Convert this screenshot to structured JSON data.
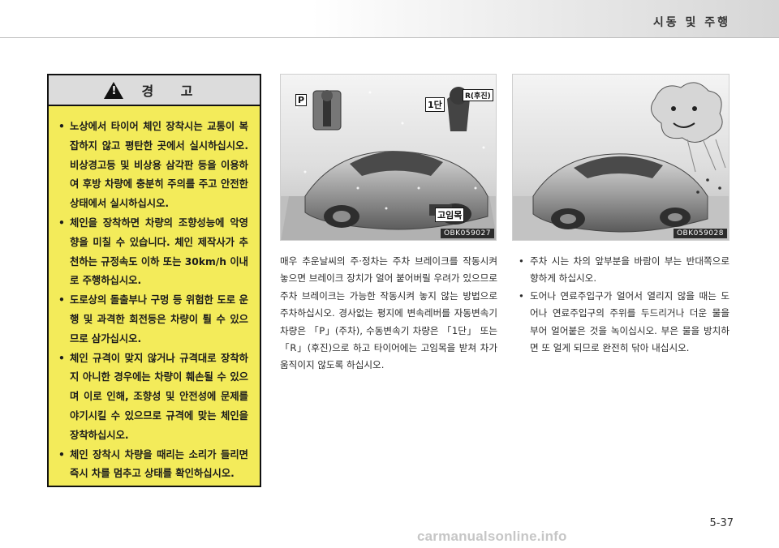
{
  "header": {
    "section_title": "시동 및 주행"
  },
  "warning": {
    "heading": "경 고",
    "items": [
      "노상에서 타이어 체인 장착시는 교통이 복잡하지 않고 평탄한 곳에서 실시하십시오. 비상경고등 및 비상용 삼각판 등을 이용하여 후방 차량에 충분히 주의를 주고 안전한 상태에서 실시하십시오.",
      "체인을 장착하면 차량의 조향성능에 악영향을 미칠 수 있습니다. 체인 제작사가 추천하는 규정속도 이하 또는 30km/h 이내로 주행하십시오.",
      "도로상의 돌출부나 구멍 등 위험한 도로 운행 및 과격한 회전등은 차량이 튈 수 있으므로 삼가십시오.",
      "체인 규격이 맞지 않거나 규격대로 장착하지 아니한 경우에는 차량이 훼손될 수 있으며 이로 인해, 조향성 및 안전성에 문제를 야기시킬 수 있으므로 규격에 맞는 체인을 장착하십시오.",
      "체인 장착시 차량을 때리는 소리가 들리면 즉시 차를 멈추고 상태를 확인하십시오."
    ]
  },
  "images": {
    "left": {
      "code": "OBK059027",
      "labels": [
        "P",
        "1단",
        "R(후진)",
        "고임목"
      ]
    },
    "right": {
      "code": "OBK059028"
    }
  },
  "main_paragraph": "매우 추운날씨의 주·정차는 주차 브레이크를 작동시켜 놓으면 브레이크 장치가 얼어 붙어버릴 우려가 있으므로 주차 브레이크는 가능한 작동시켜 놓지 않는 방법으로 주차하십시오. 경사없는 평지에 변속레버를 자동변속기 차량은 「P」(주차), 수동변속기 차량은 「1단」 또는 「R」(후진)으로 하고 타이어에는 고임목을 받쳐 차가 움직이지 않도록 하십시오.",
  "right_bullets": [
    "주차 시는 차의 앞부분을 바람이 부는 반대쪽으로 향하게 하십시오.",
    "도어나 연료주입구가 얼어서 열리지 않을 때는 도어나 연료주입구의 주위를 두드리거나 더운 물을 부어 얼어붙은 것을 녹이십시오. 부은 물을 방치하면 또 얼게 되므로 완전히 닦아 내십시오."
  ],
  "page_number": "5-37",
  "watermark": "carmanualsonline.info"
}
